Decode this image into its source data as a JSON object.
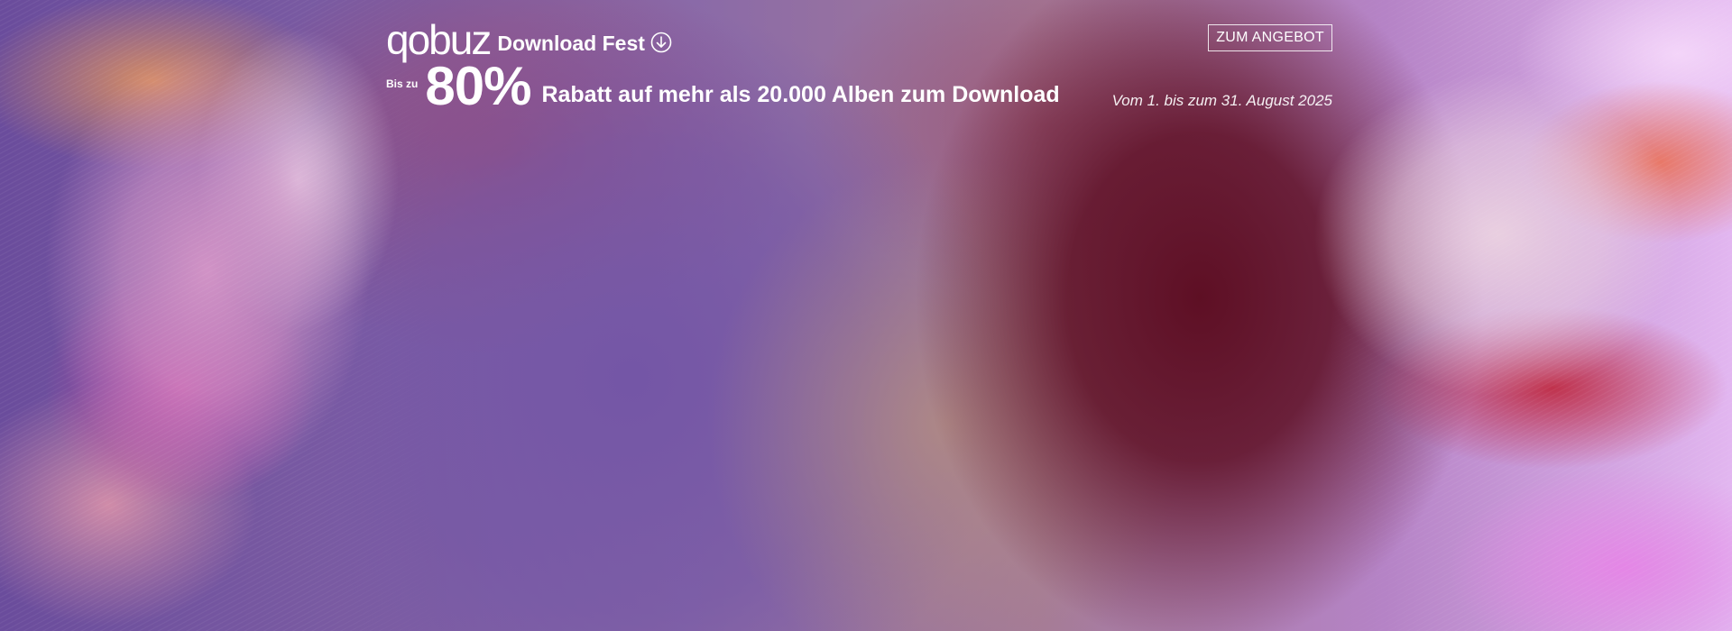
{
  "brand": {
    "logo": "qobuz",
    "event_title": "Download Fest",
    "icon": "download-circle-icon"
  },
  "cta": {
    "label": "ZUM ANGEBOT"
  },
  "promo": {
    "prefix": "Bis zu",
    "discount": "80%",
    "headline": "Rabatt auf mehr als 20.000 Alben zum Download",
    "dates": "Vom 1. bis zum 31. August 2025"
  },
  "colors": {
    "text": "#ffffff",
    "deep_red": "#5e0f24",
    "violet": "#7456a6"
  }
}
